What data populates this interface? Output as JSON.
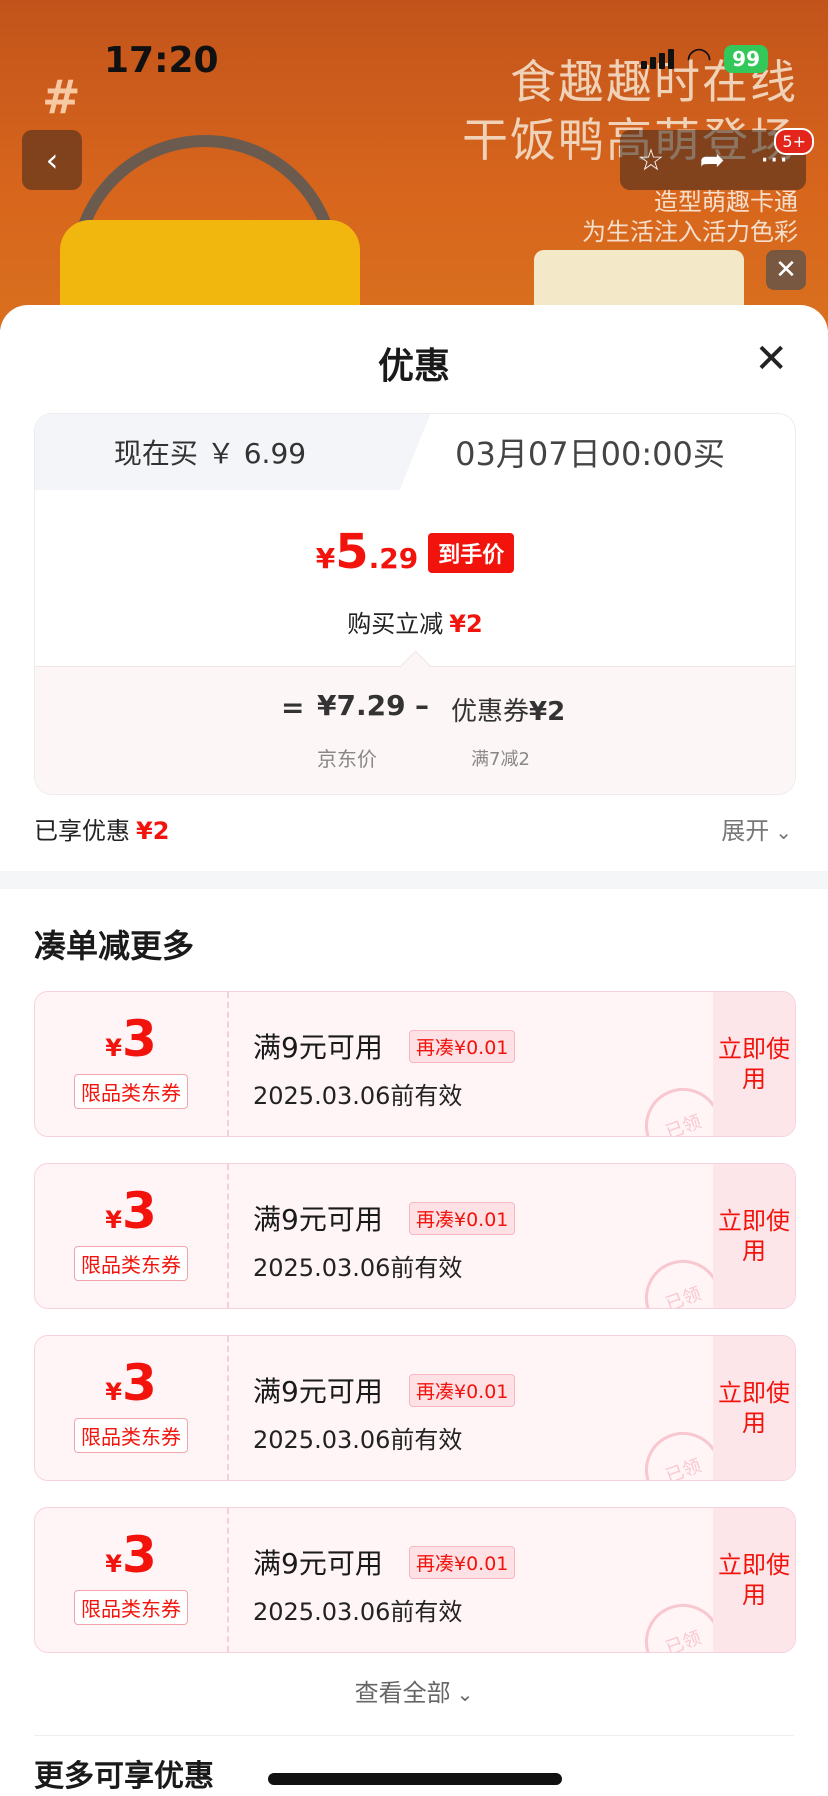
{
  "status": {
    "time": "17:20",
    "battery": "99"
  },
  "hero": {
    "hash": "#",
    "promo_line1": "食趣趣时在线",
    "promo_line2": "干饭鸭高萌登场",
    "promo_line3": "造型萌趣卡通",
    "promo_line4": "为生活注入活力色彩",
    "cart_badge": "5+"
  },
  "sheet": {
    "title": "优惠"
  },
  "tabs": {
    "now": "现在买 ￥ 6.99",
    "later": "03月07日00:00买"
  },
  "price": {
    "currency": "¥",
    "integer": "5",
    "decimal": ".29",
    "tag": "到手价",
    "reduce_label": "购买立减",
    "reduce_amount": "¥2"
  },
  "formula": {
    "eq": "=",
    "jd_price": "¥7.29",
    "minus": "–",
    "coupon_label": "优惠券",
    "coupon_amount": "¥2",
    "jd_price_label": "京东价",
    "coupon_rule": "满7减2"
  },
  "enjoyed": {
    "label": "已享优惠",
    "amount": "¥2",
    "expand": "展开"
  },
  "section": {
    "title": "凑单减更多"
  },
  "coupons": [
    {
      "currency": "¥",
      "amount": "3",
      "type": "限品类东券",
      "condition": "满9元可用",
      "more": "再凑¥0.01",
      "valid": "2025.03.06前有效",
      "action": "立即使用",
      "stamp": "已领"
    },
    {
      "currency": "¥",
      "amount": "3",
      "type": "限品类东券",
      "condition": "满9元可用",
      "more": "再凑¥0.01",
      "valid": "2025.03.06前有效",
      "action": "立即使用",
      "stamp": "已领"
    },
    {
      "currency": "¥",
      "amount": "3",
      "type": "限品类东券",
      "condition": "满9元可用",
      "more": "再凑¥0.01",
      "valid": "2025.03.06前有效",
      "action": "立即使用",
      "stamp": "已领"
    },
    {
      "currency": "¥",
      "amount": "3",
      "type": "限品类东券",
      "condition": "满9元可用",
      "more": "再凑¥0.01",
      "valid": "2025.03.06前有效",
      "action": "立即使用",
      "stamp": "已领"
    }
  ],
  "view_all": "查看全部",
  "more_title": "更多可享优惠",
  "colors": {
    "accent": "#f2140c",
    "coupon_bg": "#fff5f7"
  }
}
